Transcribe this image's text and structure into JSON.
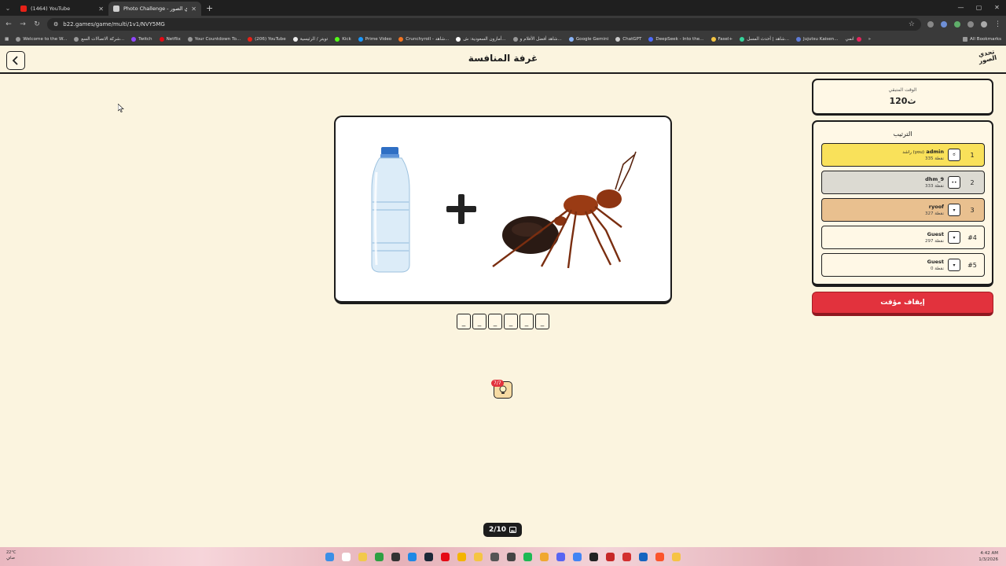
{
  "browser": {
    "tabs": [
      {
        "title": "(1464) YouTube",
        "active": false,
        "favicon_color": "#e62117"
      },
      {
        "title": "Photo Challenge - تحدي الصور",
        "active": true,
        "favicon_color": "#cfcfcf"
      }
    ],
    "new_tab": "+",
    "url": "b22.games/game/multi/1v1/NVY5MG",
    "bookmarks": [
      "Welcome to the W...",
      "شركة الاتصالات السع...",
      "Twitch",
      "Netflix",
      "Your Countdown To...",
      "(206) YouTube",
      "تويتر / الرئيسية",
      "Kick",
      "Prime Video",
      "Crunchyroll - شاهد...",
      "أمازون السعودية: ش...",
      "شاهد أفضل الأفلام و...",
      "Google Gemini",
      "ChatGPT",
      "DeepSeek - Into the...",
      "Fasel+",
      "شاهد | أحدث المسل...",
      "Jujutsu Kaisen...",
      "انمي"
    ],
    "all_bookmarks": "All Bookmarks"
  },
  "header": {
    "title": "غرفة المنافسة",
    "logo_text": "تحدي الصور"
  },
  "puzzle": {
    "items": [
      "water-bottle",
      "plus",
      "ant"
    ],
    "slots": [
      "_",
      "_",
      "_",
      "_",
      "_",
      "_"
    ]
  },
  "hint": {
    "badge": "7/7"
  },
  "progress": {
    "label": "2/10"
  },
  "timer": {
    "label": "الوقت المتبقي",
    "value": "120ث"
  },
  "ranking": {
    "title": "الترتيب",
    "players": [
      {
        "rank": "1",
        "name": "admin",
        "you_tag": "راشد (you)",
        "score": "335 نقطة",
        "color": "#f9e15a",
        "avatar": "ಠ"
      },
      {
        "rank": "2",
        "name": "dhm_9",
        "you_tag": "",
        "score": "333 نقطة",
        "color": "#dcdad2",
        "avatar": "••"
      },
      {
        "rank": "3",
        "name": "ryoof",
        "you_tag": "",
        "score": "327 نقطة",
        "color": "#e9c08f",
        "avatar": "▾"
      },
      {
        "rank": "#4",
        "name": "Guest",
        "you_tag": "",
        "score": "297 نقطة",
        "color": "#fff8e6",
        "avatar": "▾"
      },
      {
        "rank": "#5",
        "name": "Guest",
        "you_tag": "",
        "score": "0 نقطة",
        "color": "#fff8e6",
        "avatar": "▾"
      }
    ]
  },
  "stop_timer": {
    "label": "إيقاف مؤقت"
  },
  "taskbar": {
    "weather_temp": "22°C",
    "weather_text": "صافٍ",
    "time": "4:42 AM",
    "date": "1/3/2026"
  }
}
